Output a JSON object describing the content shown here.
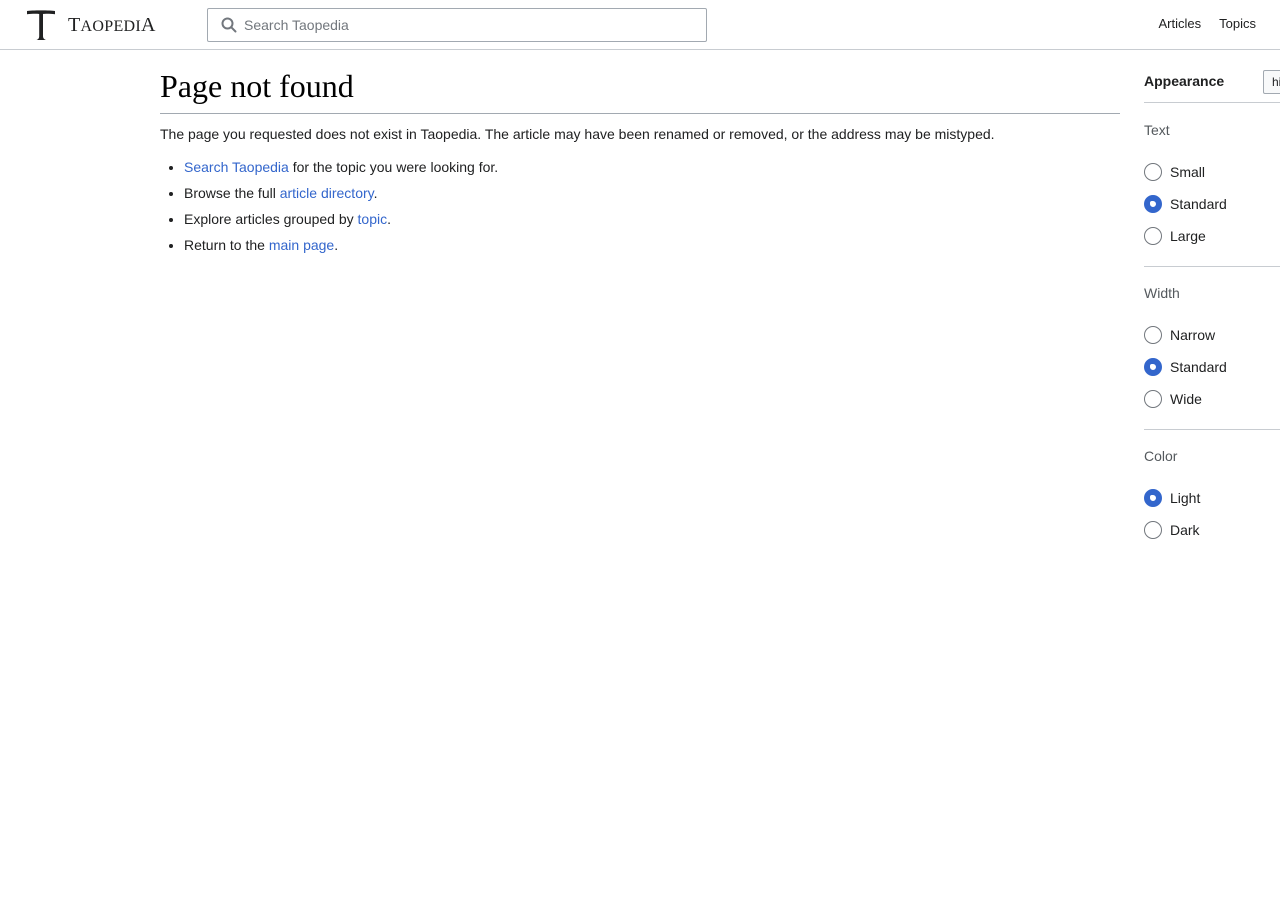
{
  "header": {
    "logo_letter": "T",
    "wordmark_first": "T",
    "wordmark_rest": "AOPEDI",
    "wordmark_last": "A",
    "search_placeholder": "Search Taopedia",
    "nav": [
      {
        "label": "Articles"
      },
      {
        "label": "Topics"
      }
    ]
  },
  "main": {
    "title": "Page not found",
    "intro": "The page you requested does not exist in Taopedia. The article may have been renamed or removed, or the address may be mistyped.",
    "suggestions": [
      {
        "link": "Search Taopedia",
        "before": "",
        "after": " for the topic you were looking for."
      },
      {
        "link": "article directory",
        "before": "Browse the full ",
        "after": "."
      },
      {
        "link": "topic",
        "before": "Explore articles grouped by ",
        "after": "."
      },
      {
        "link": "main page",
        "before": "Return to the ",
        "after": "."
      }
    ]
  },
  "appearance": {
    "title": "Appearance",
    "hide_label": "hide",
    "text": {
      "label": "Text",
      "options": [
        {
          "label": "Small",
          "checked": false
        },
        {
          "label": "Standard",
          "checked": true
        },
        {
          "label": "Large",
          "checked": false
        }
      ]
    },
    "width": {
      "label": "Width",
      "options": [
        {
          "label": "Narrow",
          "checked": false
        },
        {
          "label": "Standard",
          "checked": true
        },
        {
          "label": "Wide",
          "checked": false
        }
      ]
    },
    "color": {
      "label": "Color",
      "options": [
        {
          "label": "Light",
          "checked": true
        },
        {
          "label": "Dark",
          "checked": false
        }
      ]
    }
  },
  "colors": {
    "link": "#3366cc",
    "accent": "#3366cc",
    "border": "#c8ccd1",
    "text": "#202122"
  }
}
